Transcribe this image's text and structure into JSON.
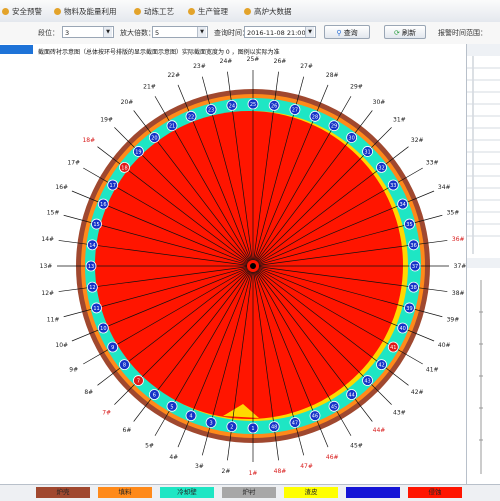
{
  "menu": [
    {
      "label": "安全预警"
    },
    {
      "label": "物料及能量利用"
    },
    {
      "label": "动炼工艺"
    },
    {
      "label": "生产管理"
    },
    {
      "label": "高炉大数据"
    }
  ],
  "toolbar": {
    "station_label": "段位：",
    "station_value": "3",
    "zoom_label": "放大倍数：",
    "zoom_value": "5",
    "time_label": "查询时间：",
    "time_value": "2016-11-08 21:00",
    "query_button": "查询",
    "refresh_button": "刷新",
    "alarm_label": "报警时间范围："
  },
  "main": {
    "title": "截面砖衬示意图（总体按环号排版的显示截面示意图）实际截面宽度为 0 ，图例以实际为准"
  },
  "ring": {
    "labels": [
      "1#",
      "2#",
      "3#",
      "4#",
      "5#",
      "6#",
      "7#",
      "8#",
      "9#",
      "10#",
      "11#",
      "12#",
      "13#",
      "14#",
      "15#",
      "16#",
      "17#",
      "18#",
      "19#",
      "20#",
      "21#",
      "22#",
      "23#",
      "24#",
      "25#",
      "26#",
      "27#",
      "28#",
      "29#",
      "30#",
      "31#",
      "32#",
      "33#",
      "34#",
      "35#",
      "36#",
      "37#",
      "38#",
      "39#",
      "40#",
      "41#",
      "42#",
      "43#",
      "44#",
      "45#",
      "46#",
      "47#",
      "48#"
    ],
    "node_numbers": [
      "1",
      "2",
      "3",
      "4",
      "5",
      "6",
      "7",
      "8",
      "9",
      "10",
      "11",
      "12",
      "13",
      "14",
      "15",
      "16",
      "17",
      "18",
      "19",
      "20",
      "21",
      "22",
      "23",
      "24",
      "25",
      "26",
      "27",
      "28",
      "29",
      "30",
      "31",
      "32",
      "33",
      "34",
      "35",
      "36",
      "37",
      "38",
      "39",
      "40",
      "41",
      "42",
      "43",
      "44",
      "45",
      "46",
      "47",
      "48"
    ],
    "alarm_labels": [
      1,
      7,
      18,
      36,
      44,
      46,
      47,
      48
    ],
    "alarm_nodes": [
      7,
      18,
      41
    ],
    "colors": {
      "core": "#ff1500",
      "cooling_wall": "#1ee6c4",
      "furnace_shell": "#a0482f",
      "filler": "#ff8a1a",
      "node_fill": "#1533c8",
      "alarm_node": "#e01a1a",
      "erosion": "#ffd800",
      "spoke": "#111111"
    }
  },
  "legend": [
    {
      "label": "炉壳",
      "color": "#a0482f"
    },
    {
      "label": "填料",
      "color": "#ff8a1a"
    },
    {
      "label": "冷却壁",
      "color": "#1ee6c4"
    },
    {
      "label": "炉衬",
      "color": "#a7a7a7"
    },
    {
      "label": "渣皮",
      "color": "#ffff00"
    },
    {
      "label": "",
      "color": "#1414d6"
    },
    {
      "label": "侵蚀",
      "color": "#ff1500"
    }
  ]
}
